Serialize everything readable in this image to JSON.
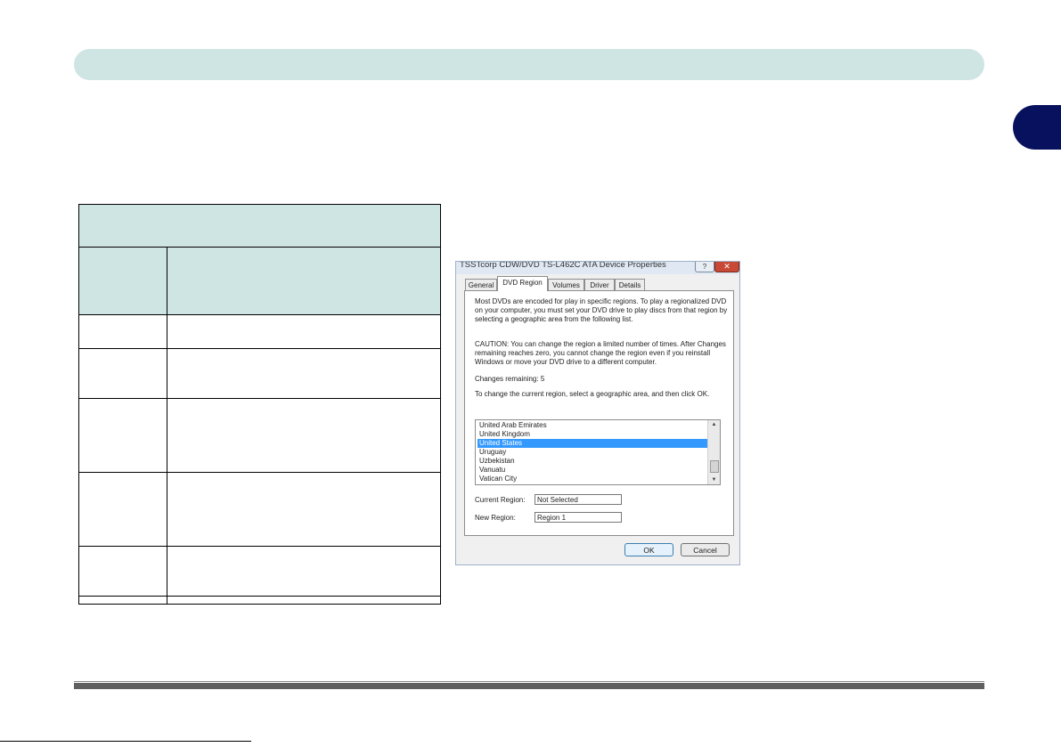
{
  "dialog": {
    "title": "TSSTcorp CDW/DVD TS-L462C ATA Device Properties",
    "help_label": "?",
    "close_label": "✕",
    "tabs": [
      {
        "label": "General"
      },
      {
        "label": "DVD Region"
      },
      {
        "label": "Volumes"
      },
      {
        "label": "Driver"
      },
      {
        "label": "Details"
      }
    ],
    "active_tab": "DVD Region",
    "intro": "Most DVDs are encoded for play in specific regions. To play a regionalized DVD on your computer, you must set your DVD drive to play discs from that region by selecting a geographic area from the following list.",
    "caution": "CAUTION:  You can change the region a limited number of times. After Changes remaining reaches zero, you cannot change the region even if you reinstall Windows or move your DVD drive to a different computer.",
    "changes_remaining": "Changes remaining: 5",
    "instruction": "To change the current region, select a geographic area, and then click OK.",
    "regions": [
      "United Arab Emirates",
      "United Kingdom",
      "United States",
      "Uruguay",
      "Uzbekistan",
      "Vanuatu",
      "Vatican City"
    ],
    "selected_region": "United States",
    "current_region_label": "Current Region:",
    "current_region_value": "Not Selected",
    "new_region_label": "New Region:",
    "new_region_value": "Region 1",
    "ok_label": "OK",
    "cancel_label": "Cancel"
  },
  "colors": {
    "header_bar": "#cfe5e3",
    "chapter_tab": "#08115e",
    "selection": "#3399ff",
    "footer_rule": "#5f5f5f"
  }
}
